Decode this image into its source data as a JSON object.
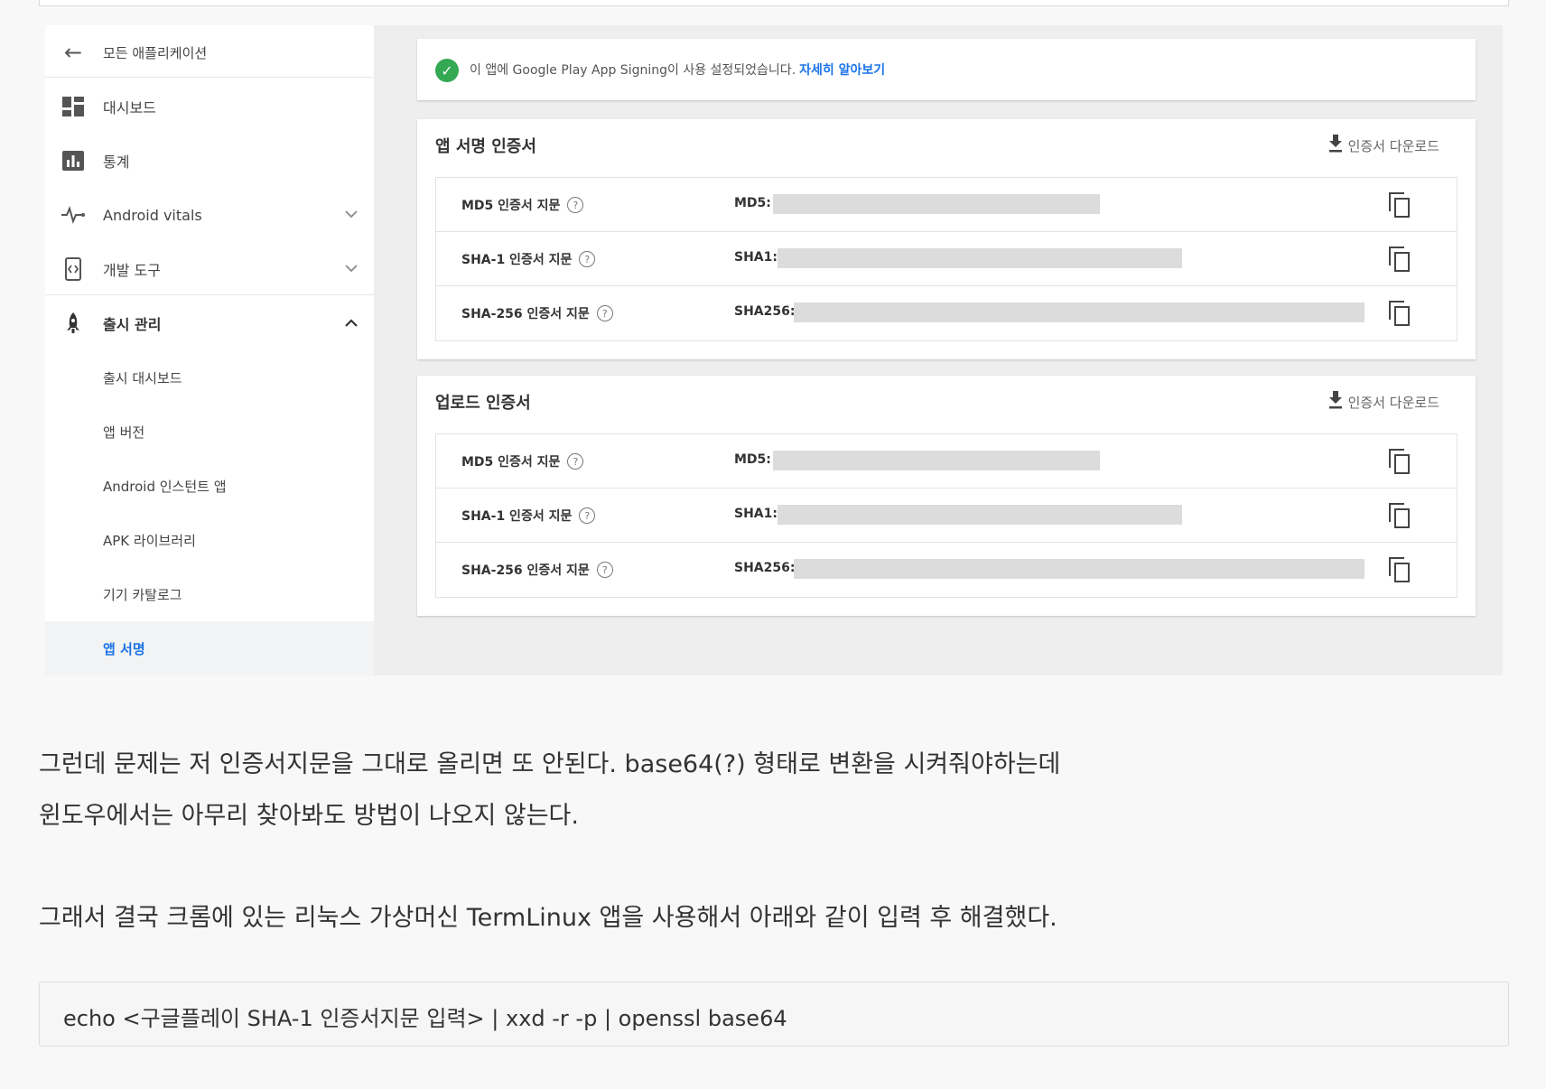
{
  "sidebar": {
    "back_label": "모든 애플리케이션",
    "items": [
      {
        "label": "대시보드"
      },
      {
        "label": "통계"
      },
      {
        "label": "Android vitals"
      },
      {
        "label": "개발 도구"
      },
      {
        "label": "출시 관리"
      }
    ],
    "sub_items": [
      {
        "label": "출시 대시보드"
      },
      {
        "label": "앱 버전"
      },
      {
        "label": "Android 인스턴트 앱"
      },
      {
        "label": "APK 라이브러리"
      },
      {
        "label": "기기 카탈로그"
      },
      {
        "label": "앱 서명"
      }
    ]
  },
  "notice": {
    "text": "이 앱에 Google Play App Signing이 사용 설정되었습니다.",
    "link": "자세히 알아보기"
  },
  "app_signing_cert": {
    "title": "앱 서명 인증서",
    "download_label": "인증서 다운로드",
    "rows": [
      {
        "label": "MD5 인증서 지문",
        "prefix": "MD5:"
      },
      {
        "label": "SHA-1 인증서 지문",
        "prefix": "SHA1:"
      },
      {
        "label": "SHA-256 인증서 지문",
        "prefix": "SHA256:"
      }
    ]
  },
  "upload_cert": {
    "title": "업로드 인증서",
    "download_label": "인증서 다운로드",
    "rows": [
      {
        "label": "MD5 인증서 지문",
        "prefix": "MD5:"
      },
      {
        "label": "SHA-1 인증서 지문",
        "prefix": "SHA1:"
      },
      {
        "label": "SHA-256 인증서 지문",
        "prefix": "SHA256:"
      }
    ]
  },
  "article": {
    "para1_line1": "그런데 문제는 저 인증서지문을 그대로 올리면 또 안된다. base64(?) 형태로 변환을 시켜줘야하는데",
    "para1_line2": "윈도우에서는 아무리 찾아봐도 방법이 나오지 않는다.",
    "para2": "그래서 결국 크롬에 있는 리눅스 가상머신 TermLinux 앱을 사용해서 아래와 같이 입력 후 해결했다.",
    "code": "echo <구글플레이 SHA-1 인증서지문 입력> | xxd -r -p | openssl base64"
  },
  "colors": {
    "accent_blue": "#1a73e8",
    "success_green": "#34a853",
    "redaction_gray": "#dcdcdc"
  }
}
